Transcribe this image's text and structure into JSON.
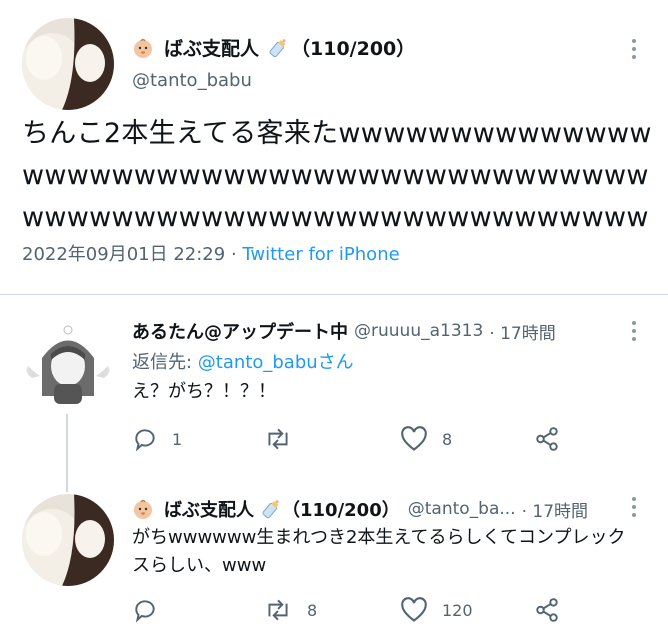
{
  "main_tweet": {
    "display_name": "ばぶ支配人",
    "count_badge": "（110/200）",
    "handle": "@tanto_babu",
    "text": "ちんこ2本生えてる客来たwwwwwwwwwwwwwwwwwwwwwwwwwwwwwwwwwwwwwwwwwwwwwwwwwwwwwwwwwwwwwwwwwwwwww",
    "timestamp": "2022年09月01日 22:29",
    "separator": " · ",
    "source": "Twitter for iPhone"
  },
  "reply_1": {
    "display_name": "あるたん@アップデート中",
    "handle": "@ruuuu_a1313",
    "time": "· 17時間",
    "reply_to_prefix": "返信先: ",
    "reply_to_user": "@tanto_babuさん",
    "text": "え？がち？！？！",
    "replies": "1",
    "retweets": "",
    "likes": "8"
  },
  "reply_2": {
    "display_name": "ばぶ支配人",
    "count_badge": "（110/200）",
    "handle": "@tanto_ba...",
    "time": "· 17時間",
    "text": "がちwwwwww生まれつき2本生えてるらしくてコンプレックスらしい、www",
    "replies": "",
    "retweets": "8",
    "likes": "120"
  },
  "icons": [
    "baby-emoji-icon",
    "baby-bottle-icon",
    "more-icon",
    "reply-icon",
    "retweet-icon",
    "like-icon",
    "share-icon"
  ],
  "colors": {
    "link": "#1d9bf0",
    "muted": "#536471",
    "text": "#0f1419",
    "divider": "#cfd9de"
  }
}
